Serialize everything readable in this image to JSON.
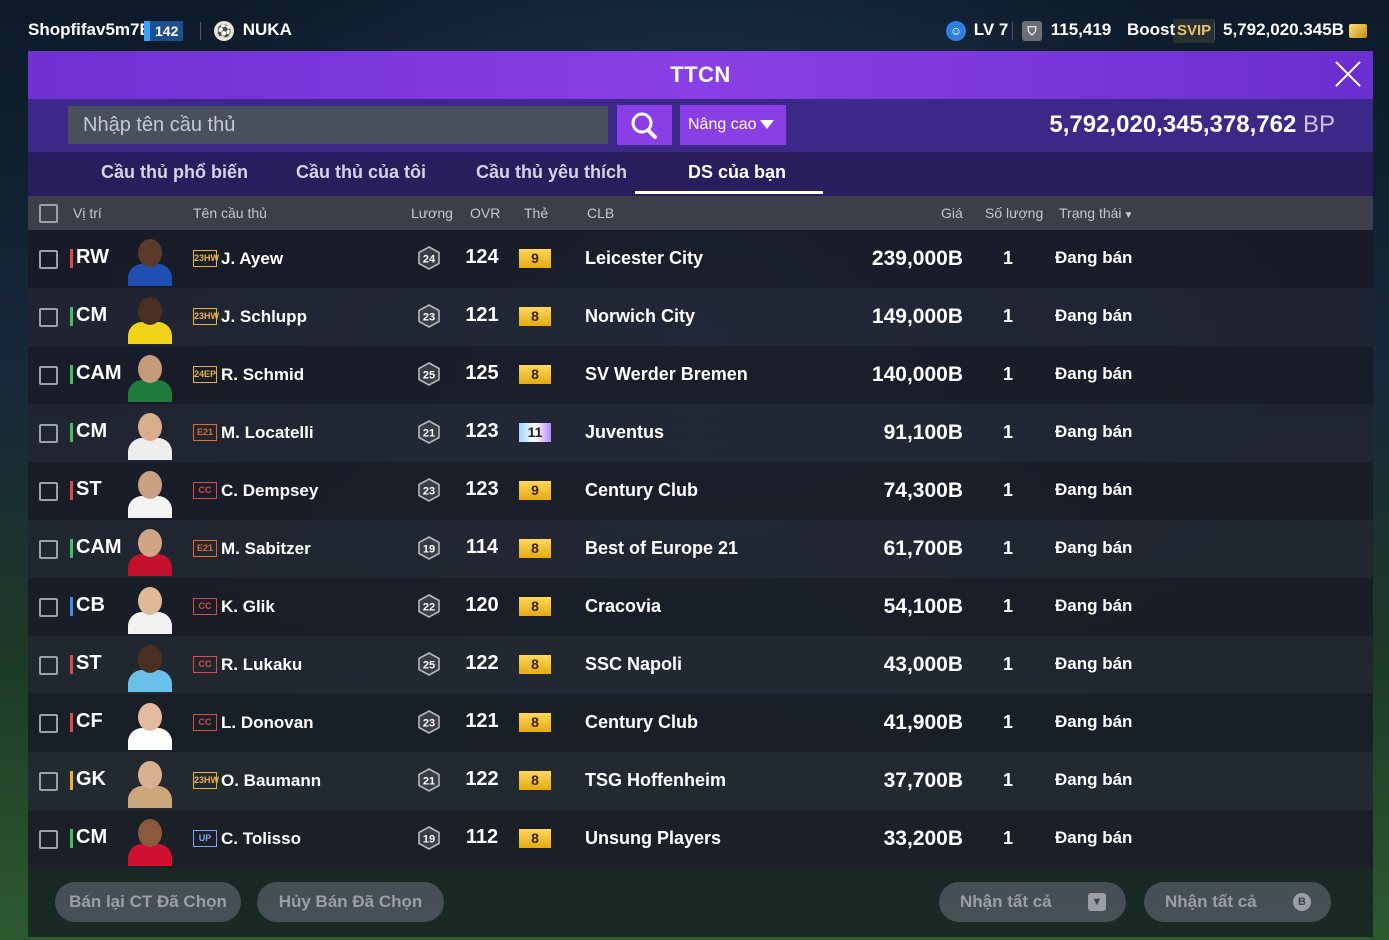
{
  "topbar": {
    "username": "Shopfifav5m7B",
    "level_badge": "142",
    "team_name": "NUKA",
    "lv": "LV 7",
    "points": "115,419",
    "boost_label": "Boost",
    "svip_label": "SVIP",
    "balance": "5,792,020.345B"
  },
  "window": {
    "title": "TTCN"
  },
  "search": {
    "placeholder": "Nhập tên cầu thủ",
    "advanced_label": "Nâng cao",
    "bp_amount": "5,792,020,345,378,762",
    "bp_unit": "BP"
  },
  "tabs": [
    {
      "label": "Cầu thủ phổ biến"
    },
    {
      "label": "Cầu thủ của tôi"
    },
    {
      "label": "Cầu thủ yêu thích"
    },
    {
      "label": "DS của bạn"
    }
  ],
  "active_tab": "DS của bạn",
  "columns": {
    "position": "Vị trí",
    "name": "Tên cầu thủ",
    "wage": "Lương",
    "ovr": "OVR",
    "grade": "Thẻ",
    "club": "CLB",
    "price": "Giá",
    "quantity": "Số lượng",
    "status": "Trạng thái"
  },
  "players": [
    {
      "position": "RW",
      "pos_color": "#e04848",
      "season": "23HW",
      "name": "J. Ayew",
      "wage": "24",
      "ovr": "124",
      "grade": "9",
      "club": "Leicester City",
      "price": "239,000B",
      "quantity": "1",
      "status": "Đang bán"
    },
    {
      "position": "CM",
      "pos_color": "#3fbf5f",
      "season": "23HW",
      "name": "J. Schlupp",
      "wage": "23",
      "ovr": "121",
      "grade": "8",
      "club": "Norwich City",
      "price": "149,000B",
      "quantity": "1",
      "status": "Đang bán"
    },
    {
      "position": "CAM",
      "pos_color": "#3fbf5f",
      "season": "24EP",
      "name": "R. Schmid",
      "wage": "25",
      "ovr": "125",
      "grade": "8",
      "club": "SV Werder Bremen",
      "price": "140,000B",
      "quantity": "1",
      "status": "Đang bán"
    },
    {
      "position": "CM",
      "pos_color": "#3fbf5f",
      "season": "E21",
      "name": "M. Locatelli",
      "wage": "21",
      "ovr": "123",
      "grade": "11",
      "club": "Juventus",
      "price": "91,100B",
      "quantity": "1",
      "status": "Đang bán"
    },
    {
      "position": "ST",
      "pos_color": "#e04848",
      "season": "CC",
      "name": "C. Dempsey",
      "wage": "23",
      "ovr": "123",
      "grade": "9",
      "club": "Century Club",
      "price": "74,300B",
      "quantity": "1",
      "status": "Đang bán"
    },
    {
      "position": "CAM",
      "pos_color": "#3fbf5f",
      "season": "E21",
      "name": "M. Sabitzer",
      "wage": "19",
      "ovr": "114",
      "grade": "8",
      "club": "Best of Europe 21",
      "price": "61,700B",
      "quantity": "1",
      "status": "Đang bán"
    },
    {
      "position": "CB",
      "pos_color": "#3a8ff0",
      "season": "CC",
      "name": "K. Glik",
      "wage": "22",
      "ovr": "120",
      "grade": "8",
      "club": "Cracovia",
      "price": "54,100B",
      "quantity": "1",
      "status": "Đang bán"
    },
    {
      "position": "ST",
      "pos_color": "#e04848",
      "season": "CC",
      "name": "R. Lukaku",
      "wage": "25",
      "ovr": "122",
      "grade": "8",
      "club": "SSC Napoli",
      "price": "43,000B",
      "quantity": "1",
      "status": "Đang bán"
    },
    {
      "position": "CF",
      "pos_color": "#e04848",
      "season": "CC",
      "name": "L. Donovan",
      "wage": "23",
      "ovr": "121",
      "grade": "8",
      "club": "Century Club",
      "price": "41,900B",
      "quantity": "1",
      "status": "Đang bán"
    },
    {
      "position": "GK",
      "pos_color": "#e8b23a",
      "season": "23HW",
      "name": "O. Baumann",
      "wage": "21",
      "ovr": "122",
      "grade": "8",
      "club": "TSG Hoffenheim",
      "price": "37,700B",
      "quantity": "1",
      "status": "Đang bán"
    },
    {
      "position": "CM",
      "pos_color": "#3fbf5f",
      "season": "UP",
      "name": "C. Tolisso",
      "wage": "19",
      "ovr": "112",
      "grade": "8",
      "club": "Unsung Players",
      "price": "33,200B",
      "quantity": "1",
      "status": "Đang bán"
    }
  ],
  "footer": {
    "resell_selected": "Bán lại CT Đã Chọn",
    "cancel_selected": "Hủy Bán Đã Chọn",
    "receive_all_players": "Nhận tất cả",
    "receive_all_bp": "Nhận tất cả"
  },
  "icons": {
    "level_icon": "smiley-face-icon",
    "points_icon": "shield-cup-icon",
    "balance_icon": "gold-coin-icon",
    "search_icon": "magnifier-icon",
    "close_icon": "close-x-icon",
    "receive_players_icon": "jersey-icon",
    "receive_bp_icon": "bp-coin-icon"
  }
}
